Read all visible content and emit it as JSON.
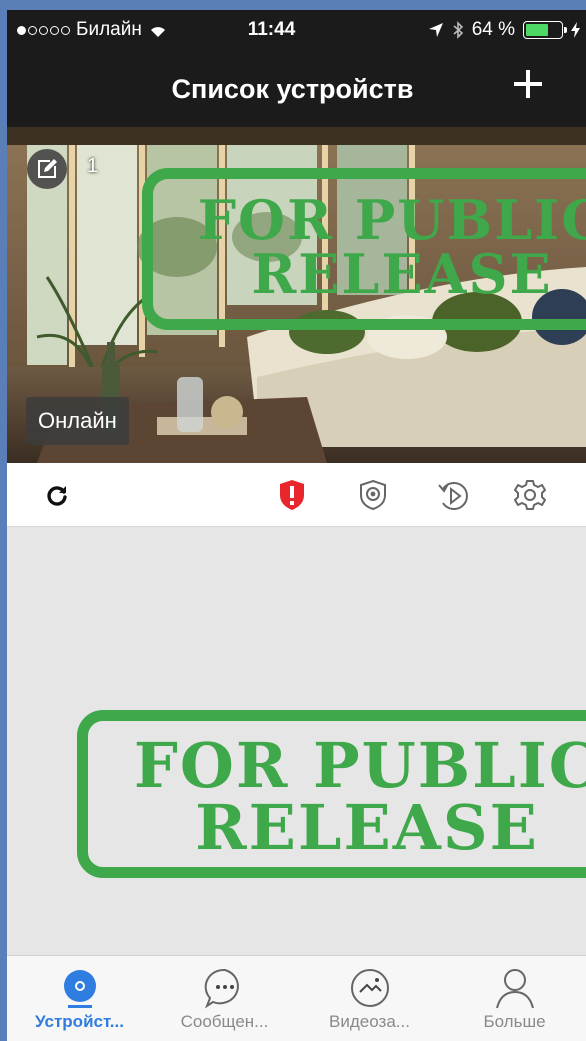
{
  "status_bar": {
    "carrier": "Билайн",
    "time": "11:44",
    "battery_text": "64 %",
    "battery_level": 0.64
  },
  "nav": {
    "title": "Список устройств"
  },
  "device": {
    "number": "1",
    "status": "Онлайн"
  },
  "watermark": {
    "line1": "FOR PUBLIC",
    "line2": "RELEASE"
  },
  "tabs": [
    {
      "label": "Устройст...",
      "active": true
    },
    {
      "label": "Сообщен...",
      "active": false
    },
    {
      "label": "Видеоза...",
      "active": false
    },
    {
      "label": "Больше",
      "active": false
    }
  ],
  "colors": {
    "accent": "#2f7de0",
    "alert": "#e8262c",
    "online_badge": "#3c3c3c",
    "stamp": "#3ea84a"
  }
}
